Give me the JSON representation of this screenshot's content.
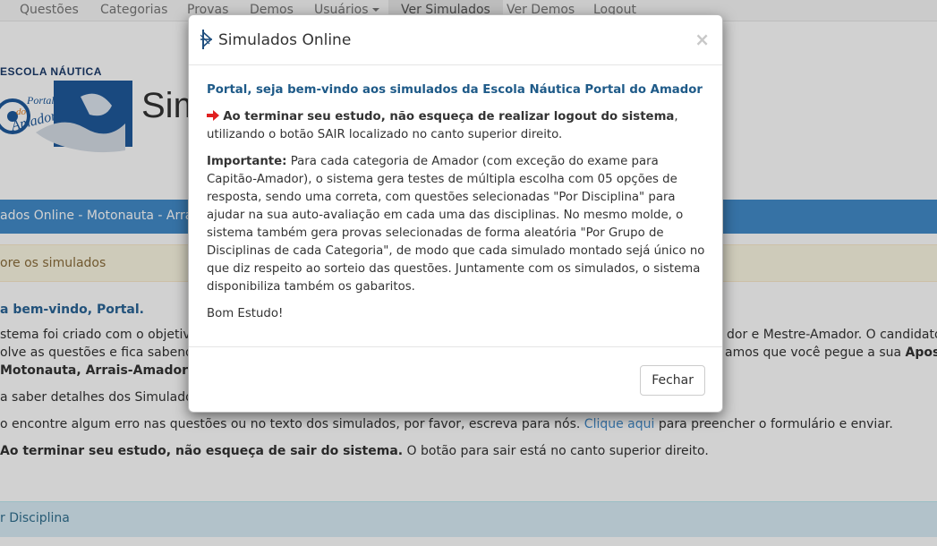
{
  "nav": {
    "items": [
      {
        "label": "Questões"
      },
      {
        "label": "Categorias"
      },
      {
        "label": "Provas"
      },
      {
        "label": "Demos"
      },
      {
        "label": "Usuários"
      },
      {
        "label": "Ver Simulados"
      },
      {
        "label": "Ver Demos"
      },
      {
        "label": "Logout"
      }
    ]
  },
  "header": {
    "logo_title": "ESCOLA NÁUTICA",
    "logo_portal": "Portal",
    "logo_do": "do",
    "logo_amador": "Amador",
    "site_title": "Sim"
  },
  "bluebar": {
    "text": "ados Online - Motonauta - Arra"
  },
  "warnbar": {
    "text": "ore os simulados"
  },
  "background": {
    "welcome": "a bem-vindo, Portal.",
    "line1": "stema foi criado com o objetivo d",
    "line1_right": "dor e Mestre-Amador. O candidato",
    "line2": "olve as questões e fica sabendo n",
    "line2_right_a": "amos que você pegue a sua ",
    "line2_right_b": "Apostila",
    "line3": "Motonauta, Arrais-Amador ou Me",
    "line4": "a saber detalhes dos Simulados e",
    "line5_a": "o encontre algum erro nas questões ou no texto dos simulados, por favor, escreva para nós. ",
    "line5_link": "Clique aqui",
    "line5_b": " para preencher o formulário e enviar.",
    "line6_a": "Ao terminar seu estudo, não esqueça de sair do sistema.",
    "line6_b": " O botão para sair está no canto superior direito.",
    "infobar": "r Disciplina"
  },
  "modal": {
    "title": "Simulados Online",
    "close_symbol": "×",
    "welcome": "Portal, seja bem-vindo aos simulados da Escola Náutica Portal do Amador",
    "logout_bold": "Ao terminar seu estudo, não esqueça de realizar logout do sistema",
    "logout_rest": ", utilizando o botão SAIR localizado no canto superior direito.",
    "important_label": "Importante:",
    "important_text": " Para cada categoria de Amador (com exceção do exame para Capitão-Amador), o sistema gera testes de múltipla escolha com 05 opções de resposta, sendo uma correta, com questões selecionadas \"Por Disciplina\" para ajudar na sua auto-avaliação em cada uma das disciplinas. No mesmo molde, o sistema também gera provas selecionadas de forma aleatória \"Por Grupo de Disciplinas de cada Categoria\", de modo que cada simulado montado sejá único no que diz respeito ao sorteio das questões. Juntamente com os simulados, o sistema disponibiliza também os gabaritos.",
    "closing": "Bom Estudo!",
    "footer_button": "Fechar",
    "arrow_color": "#e02020",
    "welcome_color": "#1e5a88"
  },
  "icons": {
    "modal_icon": "ship-wheel-icon",
    "arrow": "arrow-right-icon"
  }
}
